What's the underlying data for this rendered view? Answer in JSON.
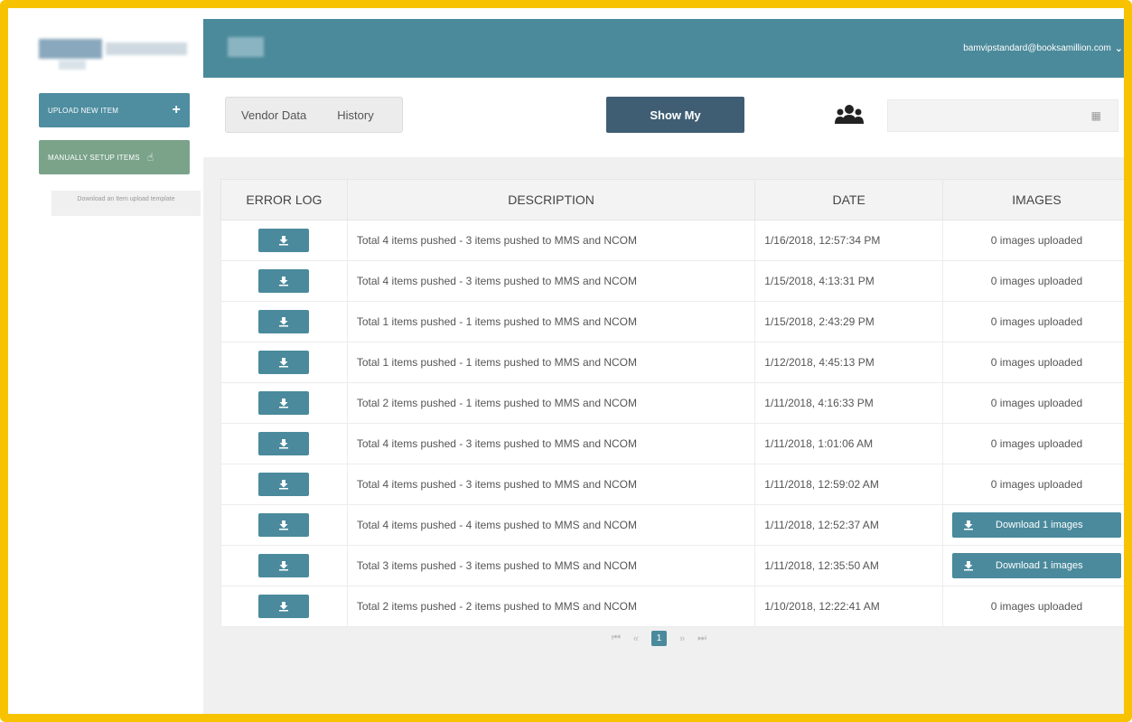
{
  "sidebar": {
    "upload_label": "UPLOAD NEW ITEM",
    "upload_icon": "plus-icon",
    "manual_label": "MANUALLY SETUP ITEMS",
    "manual_icon": "hand-pointer-icon",
    "template_label": "Download an Item upload template"
  },
  "header": {
    "user_email": "bamvipstandard@booksamillion.com",
    "dropdown_icon": "chevron-down-icon"
  },
  "toolbar": {
    "tabs": [
      "Vendor Data",
      "History"
    ],
    "show_my_label": "Show My",
    "users_icon": "users-icon",
    "calendar_icon": "calendar-icon"
  },
  "table": {
    "headers": [
      "ERROR LOG",
      "DESCRIPTION",
      "DATE",
      "IMAGES"
    ],
    "rows": [
      {
        "description": "Total 4 items pushed - 3 items pushed to MMS and NCOM",
        "date": "1/16/2018, 12:57:34 PM",
        "images": "0 images uploaded",
        "images_is_button": false
      },
      {
        "description": "Total 4 items pushed - 3 items pushed to MMS and NCOM",
        "date": "1/15/2018, 4:13:31 PM",
        "images": "0 images uploaded",
        "images_is_button": false
      },
      {
        "description": "Total 1 items pushed - 1 items pushed to MMS and NCOM",
        "date": "1/15/2018, 2:43:29 PM",
        "images": "0 images uploaded",
        "images_is_button": false
      },
      {
        "description": "Total 1 items pushed - 1 items pushed to MMS and NCOM",
        "date": "1/12/2018, 4:45:13 PM",
        "images": "0 images uploaded",
        "images_is_button": false
      },
      {
        "description": "Total 2 items pushed - 1 items pushed to MMS and NCOM",
        "date": "1/11/2018, 4:16:33 PM",
        "images": "0 images uploaded",
        "images_is_button": false
      },
      {
        "description": "Total 4 items pushed - 3 items pushed to MMS and NCOM",
        "date": "1/11/2018, 1:01:06 AM",
        "images": "0 images uploaded",
        "images_is_button": false
      },
      {
        "description": "Total 4 items pushed - 3 items pushed to MMS and NCOM",
        "date": "1/11/2018, 12:59:02 AM",
        "images": "0 images uploaded",
        "images_is_button": false
      },
      {
        "description": "Total 4 items pushed - 4 items pushed to MMS and NCOM",
        "date": "1/11/2018, 12:52:37 AM",
        "images": "Download 1 images",
        "images_is_button": true
      },
      {
        "description": "Total 3 items pushed - 3 items pushed to MMS and NCOM",
        "date": "1/11/2018, 12:35:50 AM",
        "images": "Download 1 images",
        "images_is_button": true
      },
      {
        "description": "Total 2 items pushed - 2 items pushed to MMS and NCOM",
        "date": "1/10/2018, 12:22:41 AM",
        "images": "0 images uploaded",
        "images_is_button": false
      }
    ]
  },
  "pager": {
    "first": "⏮",
    "prev": "«",
    "current": "1",
    "next": "»",
    "last": "⏭"
  },
  "colors": {
    "frame": "#f7c300",
    "header": "#4b8a9b",
    "accent": "#4a8a9c",
    "show_my": "#3f5e73",
    "manual": "#7aa38a"
  }
}
